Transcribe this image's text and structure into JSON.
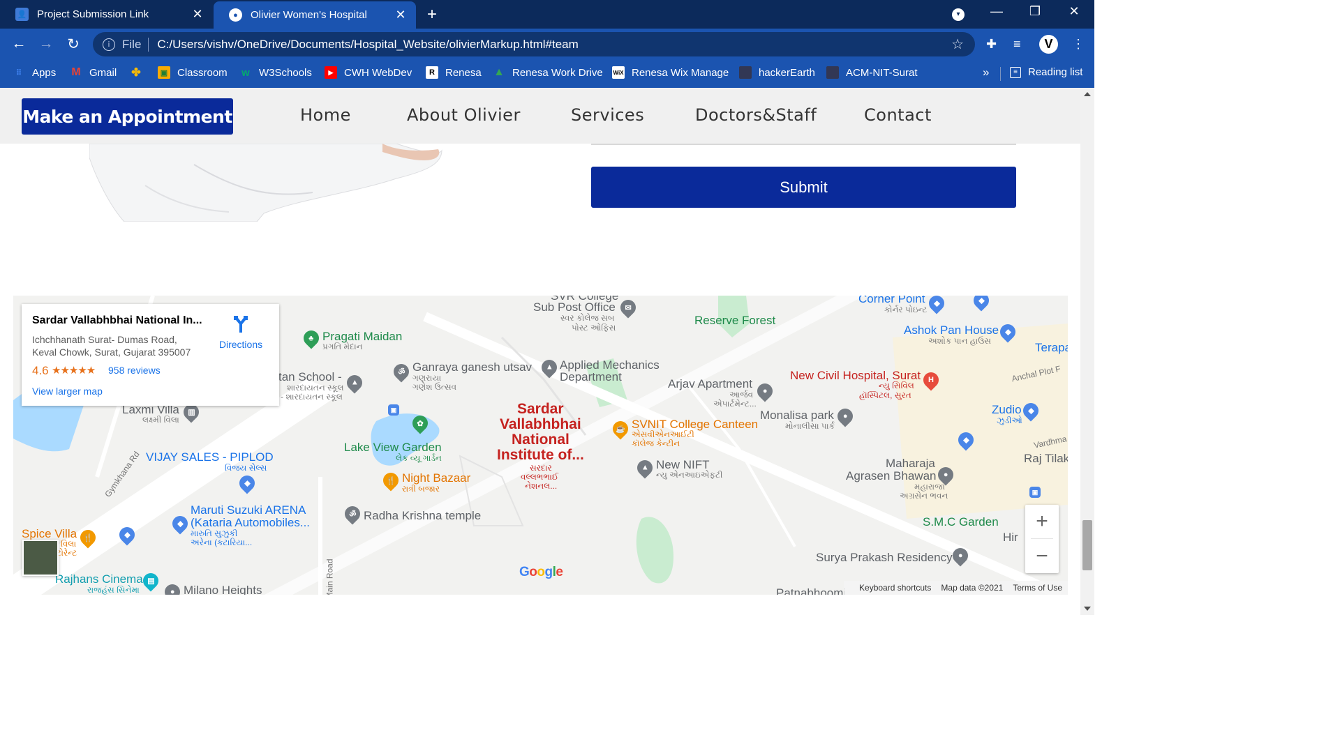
{
  "browser": {
    "tabs": [
      {
        "title": "Project Submission Link",
        "active": false
      },
      {
        "title": "Olivier Women's Hospital",
        "active": true
      }
    ],
    "address": {
      "scheme": "File",
      "url": "C:/Users/vishv/OneDrive/Documents/Hospital_Website/olivierMarkup.html#team"
    },
    "profile_initial": "V",
    "bookmarks": [
      {
        "label": "Apps",
        "icon": "apps-grid-icon",
        "color": "#4285f4"
      },
      {
        "label": "Gmail",
        "icon": "gmail-icon",
        "color": "#ea4335"
      },
      {
        "label": "",
        "icon": "google-photos-icon",
        "color": "#fbbc05"
      },
      {
        "label": "Classroom",
        "icon": "classroom-icon",
        "color": "#f9ab00"
      },
      {
        "label": "W3Schools",
        "icon": "w3schools-icon",
        "color": "#04aa6d"
      },
      {
        "label": "CWH WebDev",
        "icon": "youtube-icon",
        "color": "#ff0000"
      },
      {
        "label": "Renesa",
        "icon": "renesa-icon",
        "color": "#ffffff"
      },
      {
        "label": "Renesa Work Drive",
        "icon": "google-drive-icon",
        "color": "#34a853"
      },
      {
        "label": "Renesa Wix Manage",
        "icon": "wix-icon",
        "color": "#ffffff"
      },
      {
        "label": "hackerEarth",
        "icon": "hackerearth-icon",
        "color": "#323754"
      },
      {
        "label": "ACM-NIT-Surat",
        "icon": "acm-icon",
        "color": "#323754"
      }
    ],
    "reading_list": "Reading list"
  },
  "site": {
    "appointment_button": "Make an Appointment",
    "nav": [
      "Home",
      "About Olivier",
      "Services",
      "Doctors&Staff",
      "Contact"
    ],
    "submit_button": "Submit"
  },
  "map": {
    "card": {
      "name": "Sardar Vallabhbhai National In...",
      "address_line1": "Ichchhanath Surat- Dumas Road,",
      "address_line2": "Keval Chowk, Surat, Gujarat 395007",
      "rating": "4.6",
      "stars": "★★★★★",
      "reviews": "958 reviews",
      "directions": "Directions",
      "view_larger": "View larger map"
    },
    "places": {
      "svr_college": "SVR College",
      "sub_post_office": "Sub Post Office",
      "sub_post_office_guj": "સ્વર કોલેજ સબ",
      "sub_post_office_guj2": "પોસ્ટ ઓફિસ",
      "reserve_forest": "Reserve Forest",
      "corner_point": "Corner Point",
      "corner_point_guj": "કોર્નર પોઇન્ટ",
      "ashok_pan": "Ashok Pan House",
      "ashok_pan_guj": "અશોક પાન હાઉસ",
      "terapa": "Terapa",
      "pragati_maidan": "Pragati Maidan",
      "pragati_maidan_guj": "પ્રગતિ મેદાન",
      "ganraya": "Ganraya ganesh utsav",
      "ganraya_guj": "ગણરાયા",
      "ganraya_guj2": "ગણેશ ઉત્સવ",
      "applied_mech": "Applied Mechanics",
      "applied_mech2": "Department",
      "arjav": "Arjav Apartment",
      "arjav_guj": "આર્જવ",
      "arjav_guj2": "એપાર્ટમેન્ટ...",
      "new_civil": "New Civil Hospital, Surat",
      "new_civil_guj": "ન્યુ સિવિલ",
      "new_civil_guj2": "હૉસ્પિટલ, સુરત",
      "anchal_plot": "Anchal Plot F",
      "school": "tan School -",
      "school_guj": "શારદાયતન સ્કૂલ",
      "school_guj2": "- શારદાયતન સ્કૂલ",
      "laxmi_villa": "Laxmi Villa",
      "laxmi_villa_guj": "લક્ષ્મી વિલા",
      "lake_view": "Lake View Garden",
      "lake_view_guj": "લેક વ્યૂ ગાર્ડન",
      "svnit_1": "Sardar",
      "svnit_2": "Vallabhbhai",
      "svnit_3": "National",
      "svnit_4": "Institute of...",
      "svnit_guj1": "સરદાર",
      "svnit_guj2": "વલ્લભભાઈ",
      "svnit_guj3": "નેશનલ...",
      "canteen": "SVNIT College Canteen",
      "canteen_guj": "એસવીએનઆઈટી",
      "canteen_guj2": "કૉલેજ કેન્ટીન",
      "monalisa": "Monalisa park",
      "monalisa_guj": "મોનાલીસા પાર્ક",
      "zudio": "Zudio",
      "zudio_guj": "ઝુડીઓ",
      "vardhma": "Vardhma",
      "raj_tilak": "Raj Tilak",
      "vijay_sales": "VIJAY SALES - PIPLOD",
      "vijay_sales_guj": "વિજય સેલ્સ",
      "gymkhana": "Gymkhana Rd",
      "night_bazaar": "Night Bazaar",
      "night_bazaar_guj": "રાત્રી બજાર",
      "new_nift": "New NIFT",
      "new_nift_guj": "ન્યુ એનઆઇએફટી",
      "maharaja": "Maharaja",
      "agrasen": "Agrasen Bhawan",
      "agrasen_guj": "મહારાજા",
      "agrasen_guj2": "અગ્રસેન ભવન",
      "maruti": "Maruti Suzuki ARENA",
      "maruti2": "(Kataria Automobiles...",
      "maruti_guj": "મારુતિ સુઝુકી",
      "maruti_guj2": "અરેના (કટારિયા...",
      "radha_krishna": "Radha Krishna temple",
      "smc_garden": "S.M.C Garden",
      "spice_villa": "Spice Villa",
      "spice_villa_guj": "વિલા",
      "spice_villa_guj2": "ટોરેન્ટ",
      "hir": "Hir",
      "surya_prakash": "Surya Prakash Residency",
      "rajhans": "Rajhans Cinema",
      "rajhans_guj": "રાજહંસ સિનેમા",
      "milano": "Milano Heights",
      "main_road": "Main Road",
      "patnabhoomi": "Patnabhoomi"
    },
    "zoom_in": "+",
    "zoom_out": "−",
    "google": "Google",
    "attribution": {
      "shortcuts": "Keyboard shortcuts",
      "data": "Map data ©2021",
      "terms": "Terms of Use"
    }
  }
}
